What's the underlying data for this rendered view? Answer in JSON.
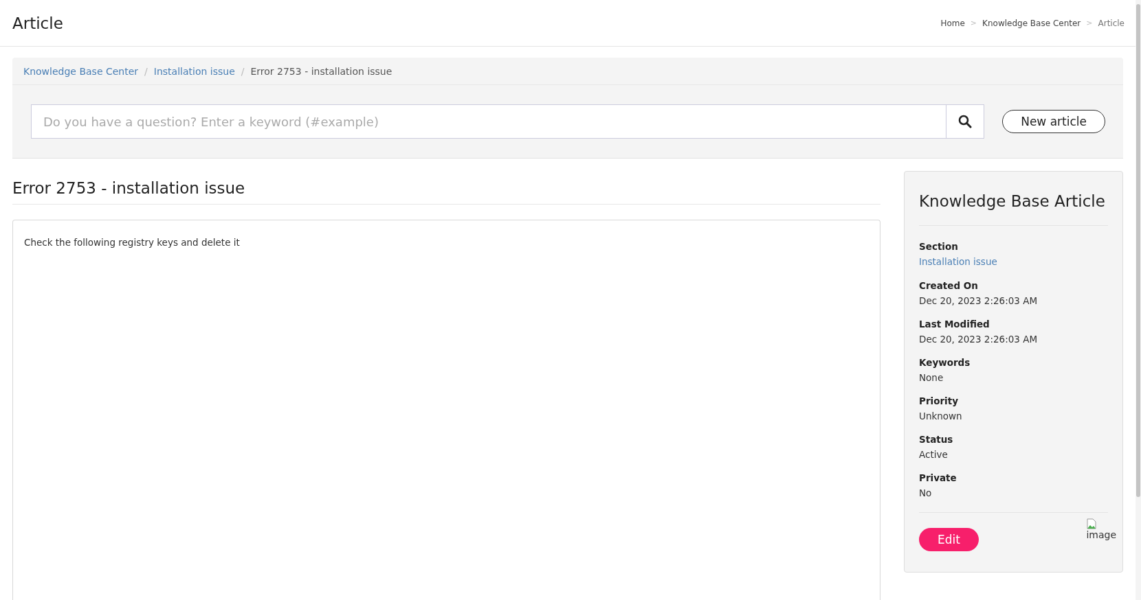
{
  "header": {
    "title": "Article",
    "breadcrumb": [
      {
        "label": "Home",
        "selected": false
      },
      {
        "label": "Knowledge Base Center",
        "selected": false
      },
      {
        "label": "Article",
        "selected": true
      }
    ],
    "separator": ">"
  },
  "path": {
    "items": [
      {
        "label": "Knowledge Base Center",
        "kind": "link"
      },
      {
        "label": "Installation issue",
        "kind": "link"
      },
      {
        "label": "Error 2753 - installation issue",
        "kind": "current"
      }
    ],
    "separator": "/"
  },
  "search": {
    "placeholder": "Do you have a question? Enter a keyword (#example)"
  },
  "new_article_button": "New article",
  "article": {
    "title": "Error 2753 - installation issue",
    "body": "Check the following registry keys and delete it"
  },
  "side_panel": {
    "title": "Knowledge Base Article",
    "fields": [
      {
        "label": "Section",
        "value": "Installation issue",
        "kind": "link"
      },
      {
        "label": "Created On",
        "value": "Dec 20, 2023 2:26:03 AM",
        "kind": "text"
      },
      {
        "label": "Last Modified",
        "value": "Dec 20, 2023 2:26:03 AM",
        "kind": "text"
      },
      {
        "label": "Keywords",
        "value": "None",
        "kind": "text"
      },
      {
        "label": "Priority",
        "value": "Unknown",
        "kind": "text"
      },
      {
        "label": "Status",
        "value": "Active",
        "kind": "text"
      },
      {
        "label": "Private",
        "value": "No",
        "kind": "text"
      }
    ],
    "edit_button": "Edit",
    "image_alt": "image"
  }
}
